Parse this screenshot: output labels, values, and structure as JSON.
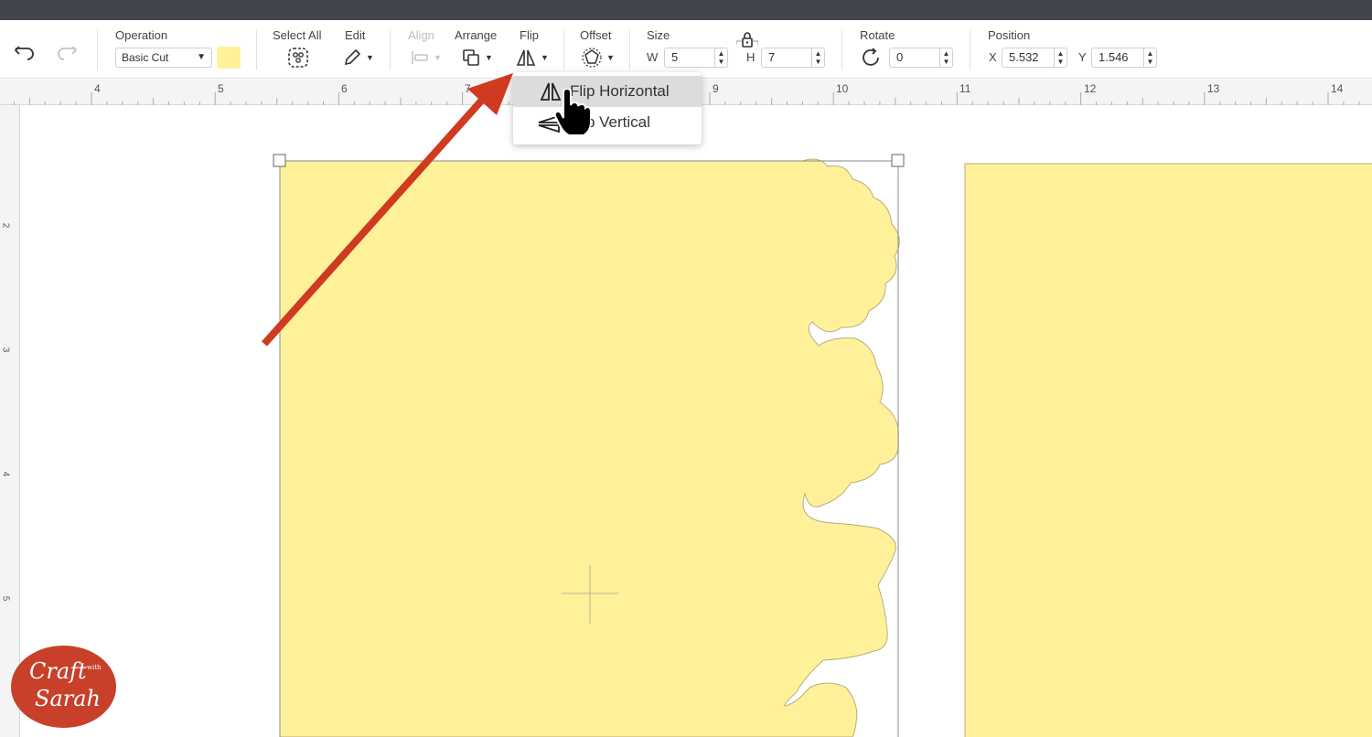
{
  "toolbar": {
    "operation": {
      "label": "Operation",
      "value": "Basic Cut",
      "swatch_color": "#fff19a"
    },
    "select_all": {
      "label": "Select All"
    },
    "edit": {
      "label": "Edit"
    },
    "align": {
      "label": "Align"
    },
    "arrange": {
      "label": "Arrange"
    },
    "flip": {
      "label": "Flip"
    },
    "offset": {
      "label": "Offset"
    },
    "size": {
      "label": "Size",
      "w_label": "W",
      "w_value": "5",
      "h_label": "H",
      "h_value": "7"
    },
    "rotate": {
      "label": "Rotate",
      "value": "0"
    },
    "position": {
      "label": "Position",
      "x_label": "X",
      "x_value": "5.532",
      "y_label": "Y",
      "y_value": "1.546"
    }
  },
  "ruler": {
    "horizontal": [
      "4",
      "5",
      "6",
      "7",
      "8",
      "9",
      "10",
      "11",
      "12",
      "13",
      "14"
    ],
    "vertical": [
      "2",
      "3",
      "4",
      "5"
    ]
  },
  "flip_menu": {
    "items": [
      {
        "label": "Flip Horizontal",
        "hovered": true
      },
      {
        "label": "Flip Vertical",
        "hovered": false
      }
    ]
  },
  "logo": {
    "line1": "Craft",
    "line2": "with",
    "line3": "Sarah"
  },
  "colors": {
    "shape_fill": "#fff19a",
    "shape_stroke": "#b9ad7a",
    "arrow": "#d03a20",
    "titlebar": "#41454b"
  },
  "icons": [
    "undo-icon",
    "redo-icon",
    "select-all-icon",
    "pencil-icon",
    "align-icon",
    "arrange-icon",
    "flip-icon",
    "offset-icon",
    "lock-icon",
    "rotate-icon",
    "pointer-hand-icon"
  ]
}
